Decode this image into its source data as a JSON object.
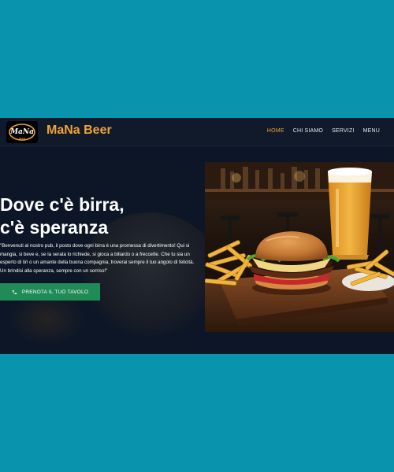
{
  "brand": {
    "logo_text": "MaNa",
    "logo_sub": "BEER",
    "name": "MaNa Beer"
  },
  "nav": {
    "items": [
      {
        "label": "HOME",
        "active": true
      },
      {
        "label": "CHI SIAMO",
        "active": false
      },
      {
        "label": "SERVIZI",
        "active": false
      },
      {
        "label": "MENU",
        "active": false
      }
    ]
  },
  "hero": {
    "title_line1": "Dove c'è birra,",
    "title_line2": "c'è speranza",
    "description": "\"Benvenuti al nostro pub, il posto dove ogni birra è una promessa di divertimento! Qui si mangia, si beve e, se la serata lo richiede, si gioca a biliardo o a freccette. Che tu sia un esperto di tiri o un amante della buona compagnia, troverai sempre il tuo angolo di felicità. Un brindisi alla speranza, sempre con un sorriso!\"",
    "cta_label": "PRENOTA IL TUO TAVOLO",
    "cta_icon": "phone-icon",
    "image": "burger-beer-fries-photo"
  },
  "colors": {
    "outer_background": "#0a93ac",
    "page_background": "#0d1626",
    "accent": "#f0a33a",
    "cta": "#1f8c57"
  }
}
